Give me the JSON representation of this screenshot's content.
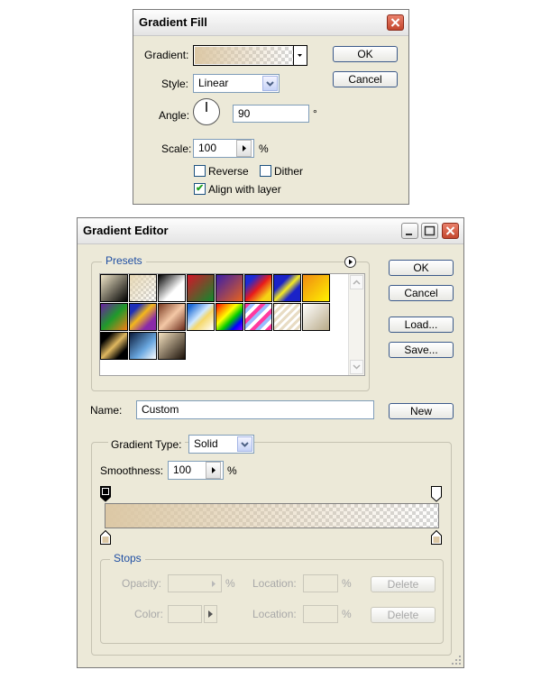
{
  "gradient_fill": {
    "title": "Gradient Fill",
    "gradient_label": "Gradient:",
    "style_label": "Style:",
    "style_value": "Linear",
    "angle_label": "Angle:",
    "angle_value": "90",
    "angle_unit": "°",
    "scale_label": "Scale:",
    "scale_value": "100",
    "scale_unit": "%",
    "reverse_label": "Reverse",
    "dither_label": "Dither",
    "align_label": "Align with layer",
    "align_checked": "✔",
    "ok_label": "OK",
    "cancel_label": "Cancel"
  },
  "gradient_editor": {
    "title": "Gradient Editor",
    "presets_label": "Presets",
    "ok_label": "OK",
    "cancel_label": "Cancel",
    "load_label": "Load...",
    "save_label": "Save...",
    "name_label": "Name:",
    "name_value": "Custom",
    "new_label": "New",
    "gradient_type_label": "Gradient Type:",
    "gradient_type_value": "Solid",
    "smoothness_label": "Smoothness:",
    "smoothness_value": "100",
    "smoothness_unit": "%",
    "stops": {
      "title": "Stops",
      "opacity_label": "Opacity:",
      "opacity_unit": "%",
      "location_label": "Location:",
      "location_unit": "%",
      "color_label": "Color:",
      "delete_label": "Delete"
    }
  },
  "colors": {
    "dialog_bg": "#ece9d8",
    "accent_blue": "#1f4fa3",
    "gradient_start": "#dcc8a5",
    "close_red": "#c3462d"
  }
}
